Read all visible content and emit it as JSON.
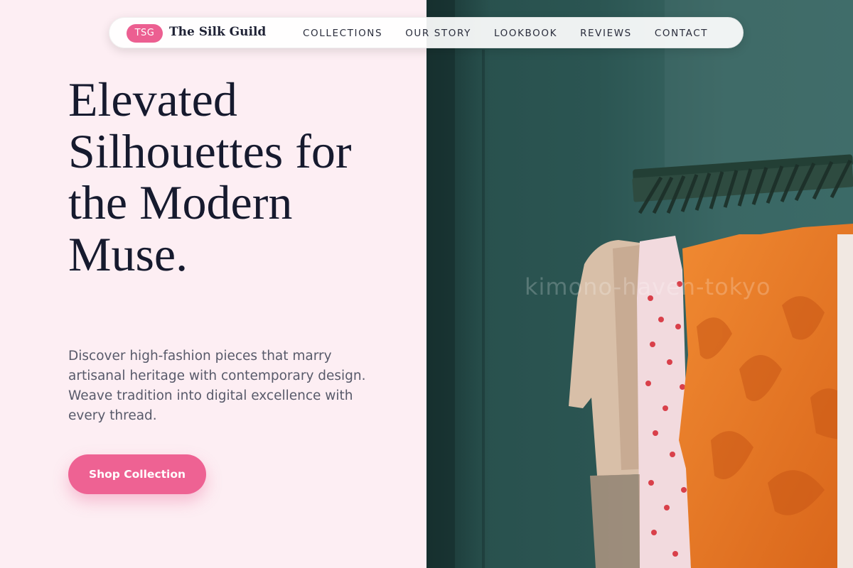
{
  "nav": {
    "brand_badge": "TSG",
    "brand_name": "The Silk Guild",
    "links": [
      "COLLECTIONS",
      "OUR STORY",
      "LOOKBOOK",
      "REVIEWS",
      "CONTACT"
    ]
  },
  "hero": {
    "title": "Elevated Silhouettes for the Modern Muse.",
    "description": "Discover high-fashion pieces that marry artisanal heritage with contemporary design. Weave tradition into digital excellence with every thread.",
    "cta_label": "Shop Collection"
  },
  "image": {
    "watermark": "kimono-haven-tokyo"
  },
  "colors": {
    "accent": "#ec5f91",
    "background": "#fdeef3",
    "heading": "#161a2e",
    "body_text": "#585a6a"
  }
}
